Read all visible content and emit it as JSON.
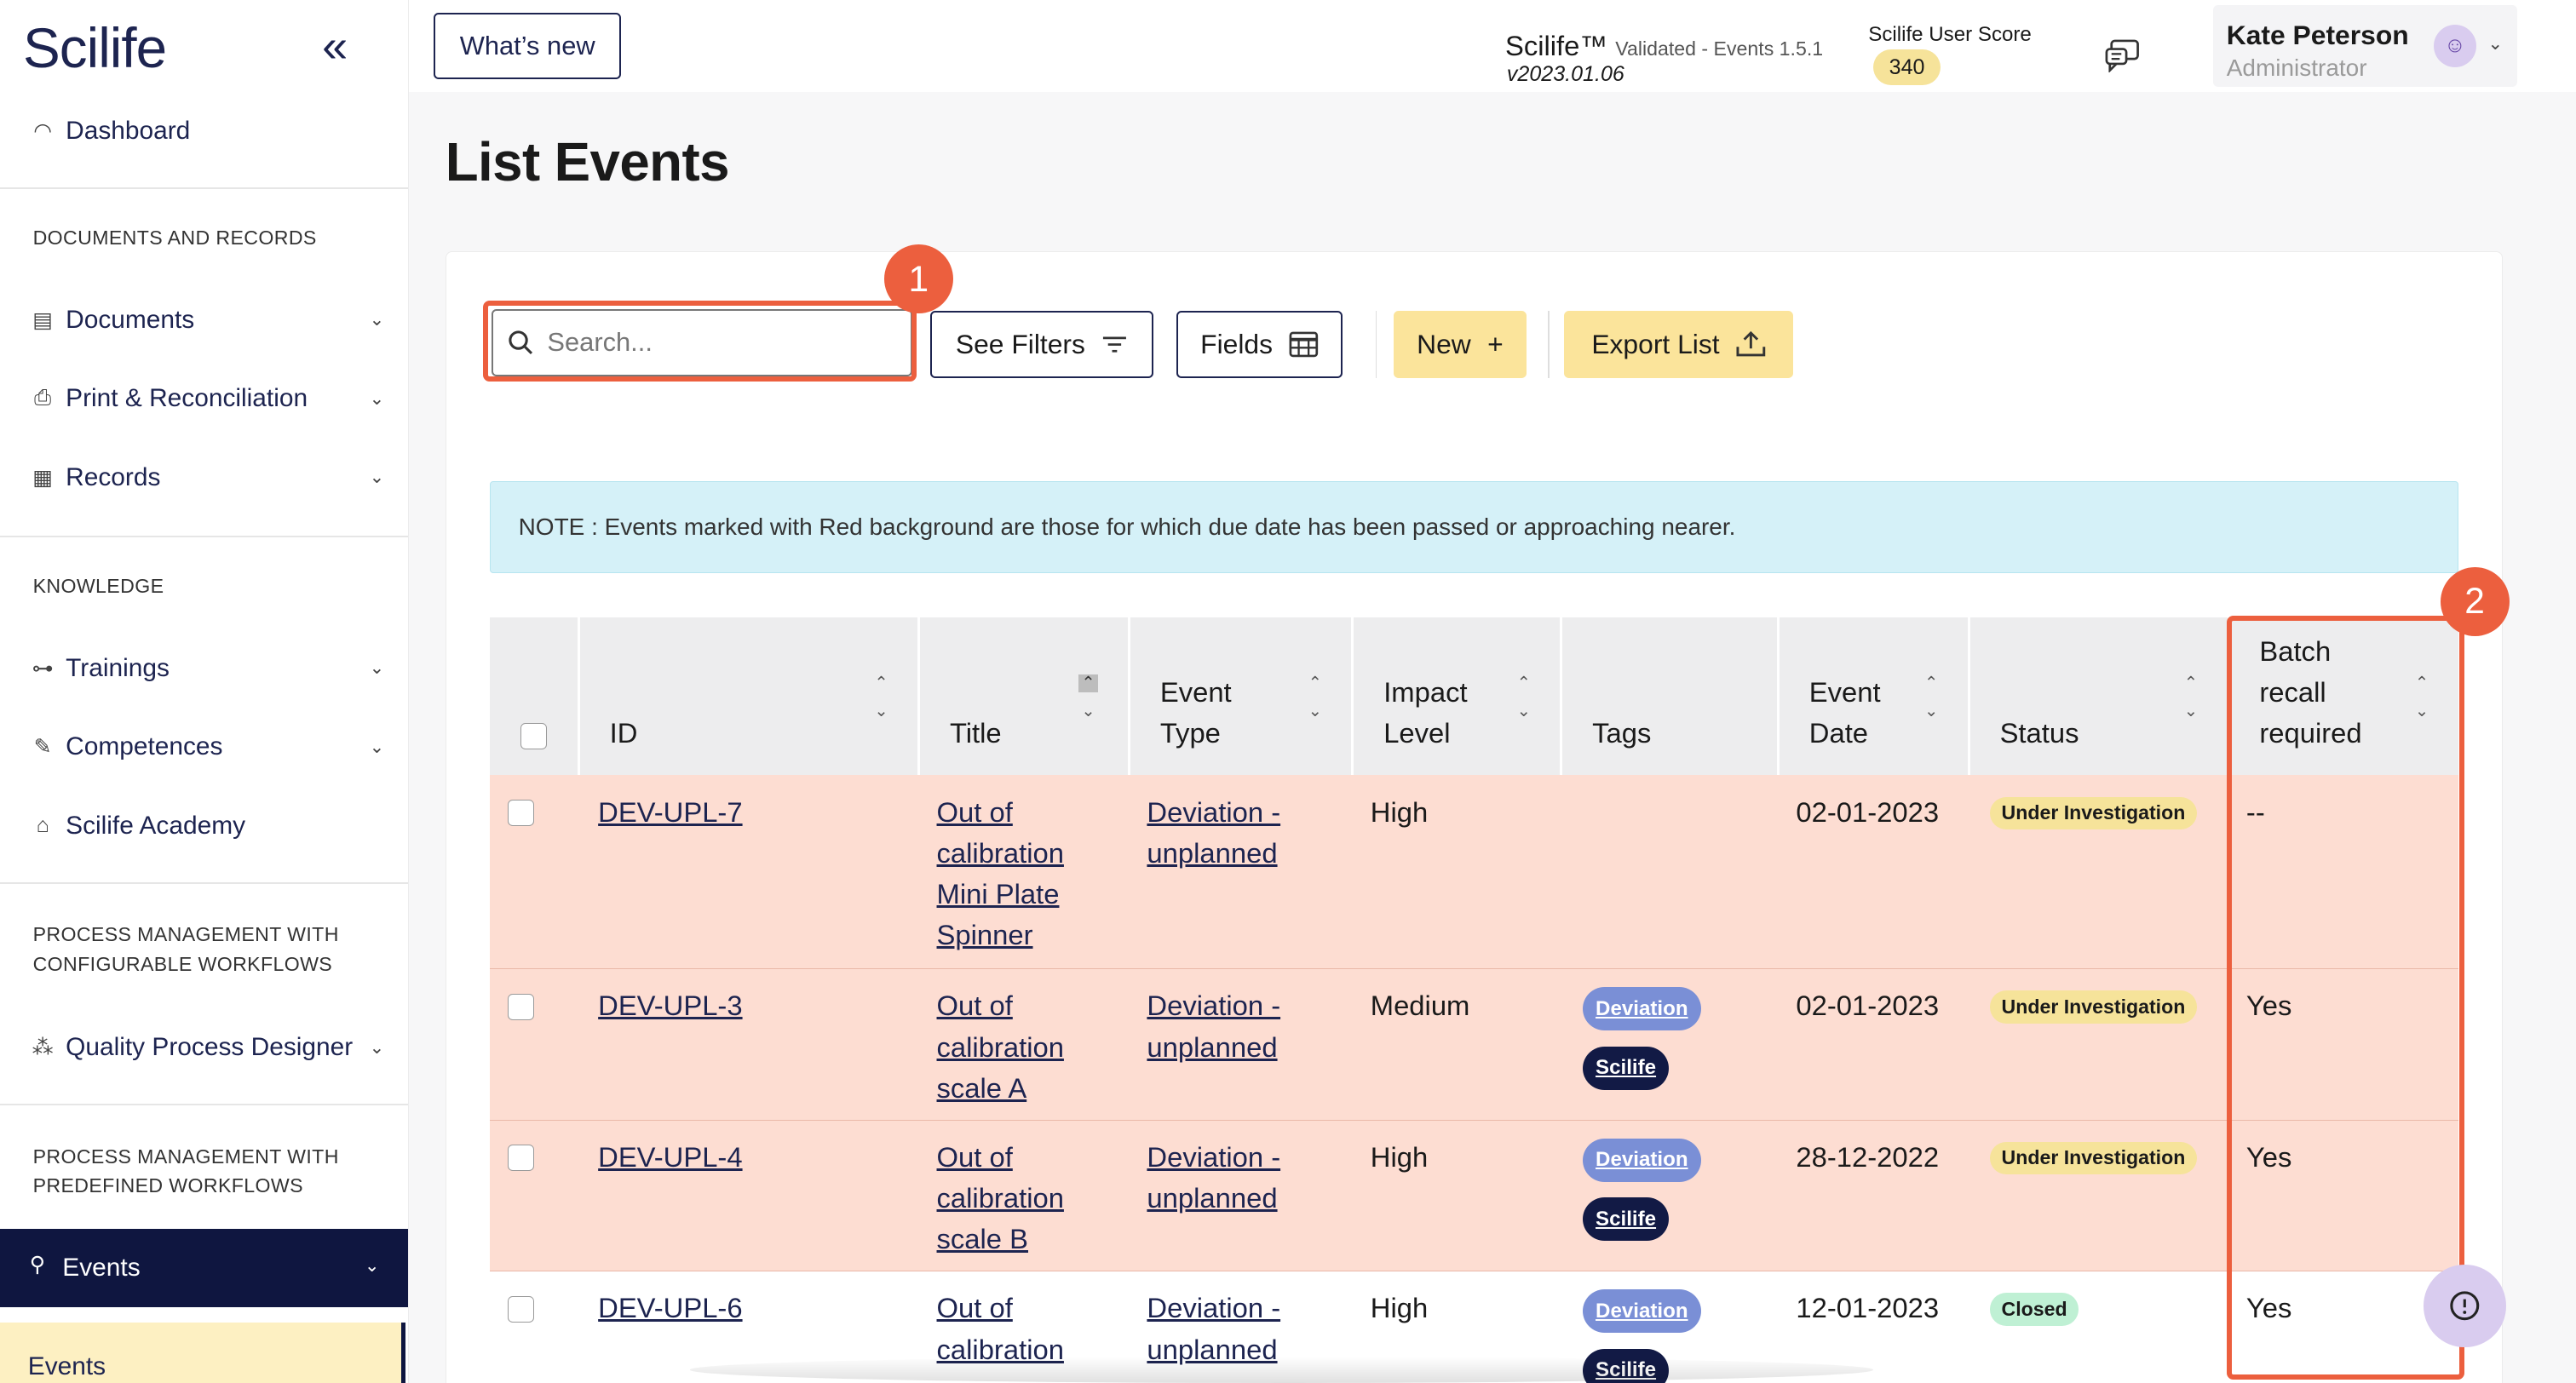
{
  "sidebar": {
    "logo": "Scilife",
    "dashboard": "Dashboard",
    "sections": {
      "documents_records": "DOCUMENTS AND RECORDS",
      "knowledge": "KNOWLEDGE",
      "process_configurable_1": "PROCESS MANAGEMENT WITH",
      "process_configurable_2": "CONFIGURABLE WORKFLOWS",
      "process_predefined_1": "PROCESS MANAGEMENT WITH",
      "process_predefined_2": "PREDEFINED WORKFLOWS"
    },
    "items": {
      "documents": "Documents",
      "print": "Print & Reconciliation",
      "records": "Records",
      "trainings": "Trainings",
      "competences": "Competences",
      "academy": "Scilife Academy",
      "quality": "Quality Process Designer",
      "events": "Events",
      "events_sub": "Events"
    }
  },
  "header": {
    "whats_new": "What’s new",
    "app_name": "Scilife™",
    "app_validated": "Validated - Events 1.5.1",
    "app_version": "v2023.01.06",
    "score_label": "Scilife User Score",
    "score_value": "340",
    "user_name": "Kate Peterson",
    "user_role": "Administrator"
  },
  "main": {
    "title": "List Events",
    "search_placeholder": "Search...",
    "see_filters": "See Filters",
    "fields": "Fields",
    "new": "New",
    "new_icon": "+",
    "export": "Export List",
    "note": "NOTE : Events marked with Red background are those for which due date has been passed or approaching nearer.",
    "markers": [
      "1",
      "2"
    ]
  },
  "table": {
    "headers": {
      "id": "ID",
      "title": "Title",
      "event_type_1": "Event",
      "event_type_2": "Type",
      "impact_1": "Impact",
      "impact_2": "Level",
      "tags": "Tags",
      "event_date_1": "Event",
      "event_date_2": "Date",
      "status": "Status",
      "batch_1": "Batch",
      "batch_2": "recall",
      "batch_3": "required"
    },
    "rows": [
      {
        "id": "DEV-UPL-7",
        "title": [
          "Out of",
          "calibration",
          "Mini Plate",
          "Spinner"
        ],
        "type": [
          "Deviation -",
          "unplanned"
        ],
        "impact": "High",
        "tags": [],
        "date": "02-01-2023",
        "status": "Under Investigation",
        "batch": "--"
      },
      {
        "id": "DEV-UPL-3",
        "title": [
          "Out of",
          "calibration",
          "scale A"
        ],
        "type": [
          "Deviation -",
          "unplanned"
        ],
        "impact": "Medium",
        "tags": [
          "Deviation",
          "Scilife"
        ],
        "date": "02-01-2023",
        "status": "Under Investigation",
        "batch": "Yes"
      },
      {
        "id": "DEV-UPL-4",
        "title": [
          "Out of",
          "calibration",
          "scale B"
        ],
        "type": [
          "Deviation -",
          "unplanned"
        ],
        "impact": "High",
        "tags": [
          "Deviation",
          "Scilife"
        ],
        "date": "28-12-2022",
        "status": "Under Investigation",
        "batch": "Yes"
      },
      {
        "id": "DEV-UPL-6",
        "title": [
          "Out of",
          "calibration"
        ],
        "type": [
          "Deviation -",
          "unplanned"
        ],
        "impact": "High",
        "tags": [
          "Deviation",
          "Scilife"
        ],
        "date": "12-01-2023",
        "status": "Closed",
        "batch": "Yes"
      }
    ]
  },
  "colors": {
    "navy": "#1d2450",
    "highlight": "#ec5f3e",
    "overdue_row": "#fdddd2",
    "yellow_button": "#fbe49b",
    "note_bg": "#d5f1f8"
  },
  "icons": {
    "collapse": "double-chevron-left-icon",
    "search": "search-icon",
    "filter": "filter-icon",
    "fields": "table-grid-icon",
    "export": "upload-icon",
    "chat": "chat-icon",
    "help": "help-icon"
  }
}
